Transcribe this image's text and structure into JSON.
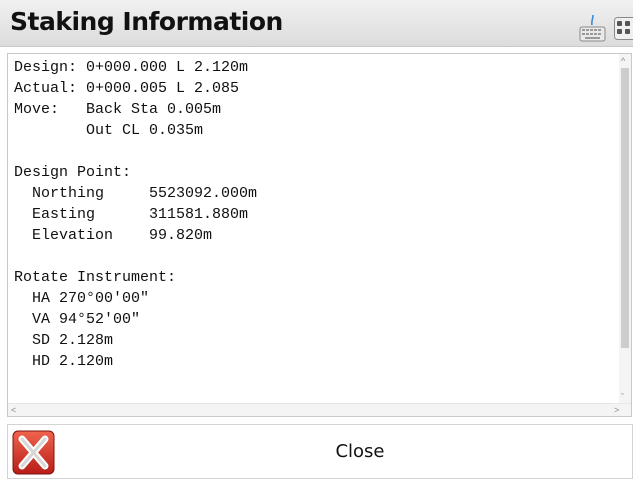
{
  "window": {
    "title": "Staking Information"
  },
  "toolbar": {
    "keyboard_icon": "keyboard-icon",
    "grid_icon": "grid-icon"
  },
  "report": {
    "lines": [
      "Design: 0+000.000 L 2.120m",
      "Actual: 0+000.005 L 2.085",
      "Move:   Back Sta 0.005m",
      "        Out CL 0.035m",
      "",
      "Design Point:",
      "  Northing     5523092.000m",
      "  Easting      311581.880m",
      "  Elevation    99.820m",
      "",
      "Rotate Instrument:",
      "  HA 270°00'00\"",
      "  VA 94°52'00\"",
      "  SD 2.128m",
      "  HD 2.120m"
    ]
  },
  "footer": {
    "close_label": "Close",
    "close_icon": "close-x-icon"
  },
  "colors": {
    "title_bar": "#e6e6e6",
    "close_red": "#d9302a",
    "text": "#111111"
  }
}
